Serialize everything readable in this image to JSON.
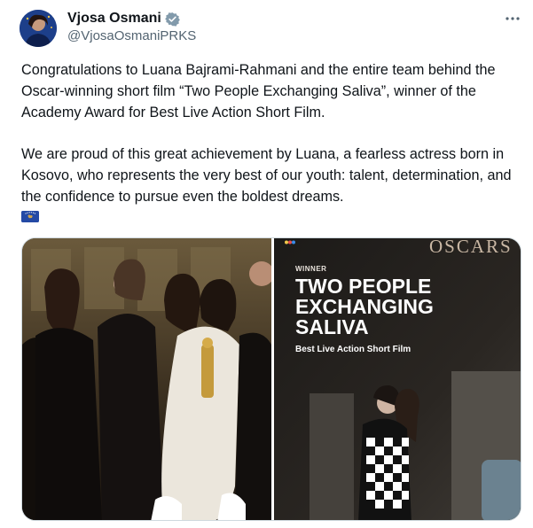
{
  "author": {
    "name": "Vjosa Osmani",
    "handle": "@VjosaOsmaniPRKS",
    "avatar_icon": "profile-avatar",
    "verified_icon": "verified-badge-icon"
  },
  "more_icon": "more-options-icon",
  "post": {
    "paragraph1": "Congratulations to Luana Bajrami-Rahmani and the entire team behind the Oscar-winning short film “Two People Exchanging Saliva”, winner of the Academy Award for Best Live Action Short Film.",
    "paragraph2": "We are proud of this great achievement by Luana, a fearless actress born in Kosovo, who represents the very best of our youth: talent, determination, and the confidence to pursue even the boldest dreams.",
    "emoji": "kosovo-flag-emoji"
  },
  "media": {
    "right_image": {
      "brand": "OSCARS",
      "winner_label": "WINNER",
      "title_lines": [
        "TWO PEOPLE",
        "EXCHANGING",
        "SALIVA"
      ],
      "category": "Best Live Action Short Film"
    }
  },
  "colors": {
    "text": "#0f1419",
    "secondary": "#536471",
    "verified": "#829aab",
    "border": "#cfd9de"
  }
}
